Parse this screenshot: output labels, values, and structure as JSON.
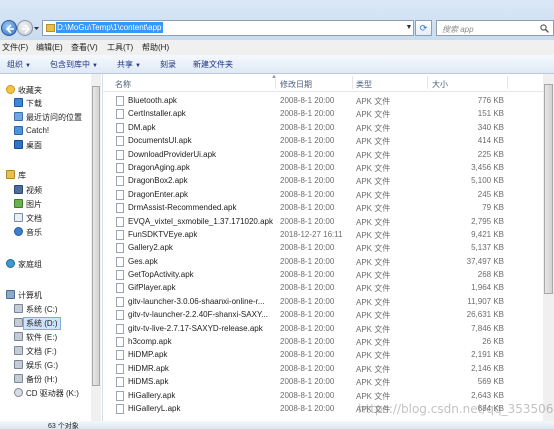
{
  "address_bar": {
    "path": "D:\\MoGu\\Temp\\1\\content\\app",
    "search_placeholder": "搜索 app"
  },
  "menu": [
    "文件(F)",
    "编辑(E)",
    "查看(V)",
    "工具(T)",
    "帮助(H)"
  ],
  "toolbar": [
    "组织",
    "包含到库中",
    "共享",
    "刻录",
    "新建文件夹"
  ],
  "sidebar": {
    "favorites": {
      "label": "收藏夹",
      "items": [
        "下载",
        "最近访问的位置",
        "Catch!",
        "桌面"
      ]
    },
    "library": {
      "label": "库",
      "items": [
        "视频",
        "图片",
        "文档",
        "音乐"
      ]
    },
    "homegroup": "家庭组",
    "computer": {
      "label": "计算机",
      "items": [
        "系统 (C:)",
        "系统 (D:)",
        "软件 (E:)",
        "文档 (F:)",
        "娱乐 (G:)",
        "备份 (H:)",
        "CD 驱动器 (K:)"
      ]
    },
    "selected": "系统 (D:)"
  },
  "columns": {
    "name": "名称",
    "date": "修改日期",
    "type": "类型",
    "size": "大小"
  },
  "files": [
    {
      "name": "Bluetooth.apk",
      "date": "2008-8-1 20:00",
      "type": "APK 文件",
      "size": "776 KB"
    },
    {
      "name": "CertInstaller.apk",
      "date": "2008-8-1 20:00",
      "type": "APK 文件",
      "size": "151 KB"
    },
    {
      "name": "DM.apk",
      "date": "2008-8-1 20:00",
      "type": "APK 文件",
      "size": "340 KB"
    },
    {
      "name": "DocumentsUI.apk",
      "date": "2008-8-1 20:00",
      "type": "APK 文件",
      "size": "414 KB"
    },
    {
      "name": "DownloadProviderUi.apk",
      "date": "2008-8-1 20:00",
      "type": "APK 文件",
      "size": "225 KB"
    },
    {
      "name": "DragonAging.apk",
      "date": "2008-8-1 20:00",
      "type": "APK 文件",
      "size": "3,456 KB"
    },
    {
      "name": "DragonBox2.apk",
      "date": "2008-8-1 20:00",
      "type": "APK 文件",
      "size": "5,100 KB"
    },
    {
      "name": "DragonEnter.apk",
      "date": "2008-8-1 20:00",
      "type": "APK 文件",
      "size": "245 KB"
    },
    {
      "name": "DrmAssist-Recommended.apk",
      "date": "2008-8-1 20:00",
      "type": "APK 文件",
      "size": "79 KB"
    },
    {
      "name": "EVQA_vixtel_sxmobile_1.37.171020.apk",
      "date": "2008-8-1 20:00",
      "type": "APK 文件",
      "size": "2,795 KB"
    },
    {
      "name": "FunSDKTVEye.apk",
      "date": "2018-12-27 16:11",
      "type": "APK 文件",
      "size": "9,421 KB"
    },
    {
      "name": "Gallery2.apk",
      "date": "2008-8-1 20:00",
      "type": "APK 文件",
      "size": "5,137 KB"
    },
    {
      "name": "Ges.apk",
      "date": "2008-8-1 20:00",
      "type": "APK 文件",
      "size": "37,497 KB"
    },
    {
      "name": "GetTopActivity.apk",
      "date": "2008-8-1 20:00",
      "type": "APK 文件",
      "size": "268 KB"
    },
    {
      "name": "GifPlayer.apk",
      "date": "2008-8-1 20:00",
      "type": "APK 文件",
      "size": "1,964 KB"
    },
    {
      "name": "gitv-launcher-3.0.06-shaanxi-online-r...",
      "date": "2008-8-1 20:00",
      "type": "APK 文件",
      "size": "11,907 KB"
    },
    {
      "name": "gitv-tv-launcher-2.2.40F-shanxi-SAXY...",
      "date": "2008-8-1 20:00",
      "type": "APK 文件",
      "size": "26,631 KB"
    },
    {
      "name": "gitv-tv-live-2.7.17-SAXYD-release.apk",
      "date": "2008-8-1 20:00",
      "type": "APK 文件",
      "size": "7,846 KB"
    },
    {
      "name": "h3comp.apk",
      "date": "2008-8-1 20:00",
      "type": "APK 文件",
      "size": "26 KB"
    },
    {
      "name": "HiDMP.apk",
      "date": "2008-8-1 20:00",
      "type": "APK 文件",
      "size": "2,191 KB"
    },
    {
      "name": "HiDMR.apk",
      "date": "2008-8-1 20:00",
      "type": "APK 文件",
      "size": "2,146 KB"
    },
    {
      "name": "HiDMS.apk",
      "date": "2008-8-1 20:00",
      "type": "APK 文件",
      "size": "569 KB"
    },
    {
      "name": "HiGallery.apk",
      "date": "2008-8-1 20:00",
      "type": "APK 文件",
      "size": "2,643 KB"
    },
    {
      "name": "HiGalleryL.apk",
      "date": "2008-8-1 20:00",
      "type": "APK 文件",
      "size": "684 KB"
    }
  ],
  "status": "63 个对象",
  "watermark": "https://blog.csdn.net/qq_35350654",
  "colors": {
    "selection": "#3399ff",
    "accent": "#1e3287"
  }
}
